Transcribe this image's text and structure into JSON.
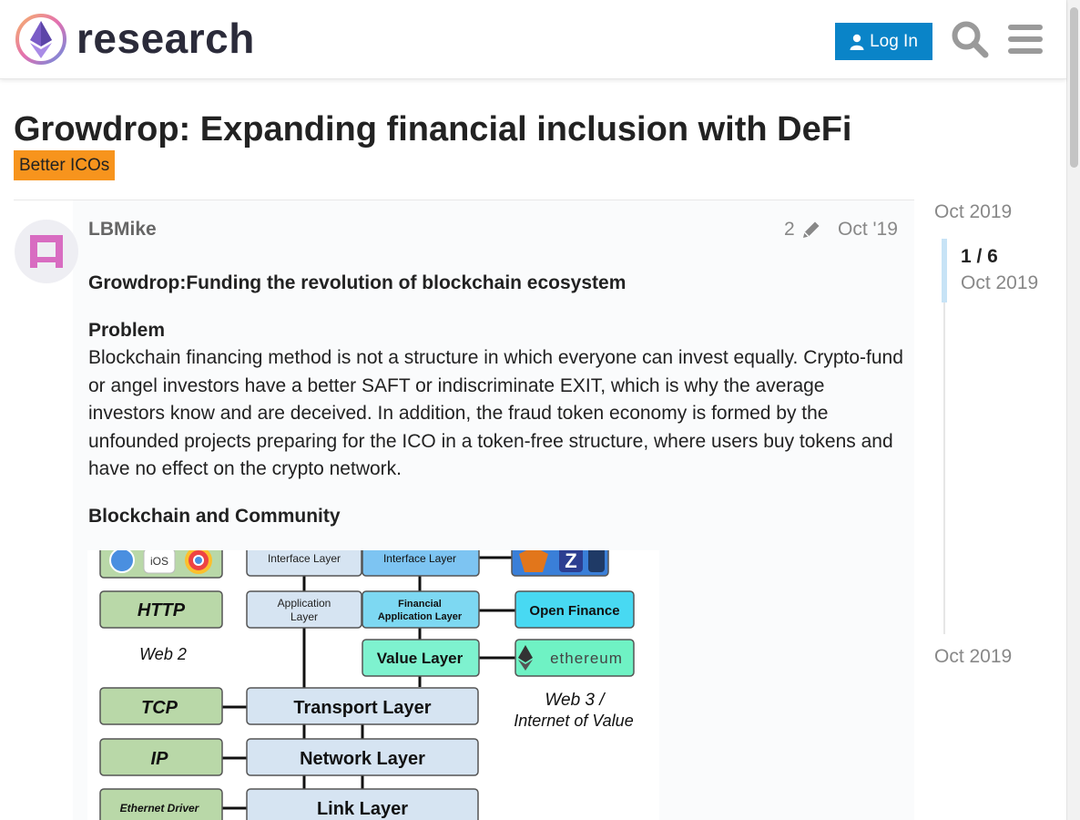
{
  "header": {
    "logo_word": "research",
    "login_label": "Log In"
  },
  "topic": {
    "title": "Growdrop: Expanding financial inclusion with DeFi",
    "category": "Better ICOs",
    "category_color": "#f7941d"
  },
  "post": {
    "username": "LBMike",
    "edit_count": "2",
    "date": "Oct '19",
    "heading": "Growdrop:Funding the revolution of blockchain ecosystem",
    "problem_title": "Problem",
    "problem_text": "Blockchain financing method is not a structure in which everyone can invest equally. Crypto-fund or angel investors have a better SAFT or indiscriminate EXIT, which is why the average investors know and are deceived. In addition, the fraud token economy is formed by the unfounded projects preparing for the ICO in a token-free structure, where users buy tokens and have no effect on the crypto network.",
    "section2_title": "Blockchain and Community"
  },
  "diagram": {
    "left": [
      "iOS",
      "HTTP",
      "Web 2",
      "TCP",
      "IP",
      "Ethernet Driver"
    ],
    "middle": [
      "Interface Layer",
      "Application Layer",
      "Transport Layer",
      "Network Layer",
      "Link Layer"
    ],
    "web3": [
      "Interface Layer",
      "Financial Application Layer",
      "Value Layer"
    ],
    "right": [
      "Open Finance",
      "ethereum",
      "Web 3 /",
      "Internet of Value"
    ]
  },
  "timeline": {
    "top_date": "Oct 2019",
    "position": "1 / 6",
    "position_date": "Oct 2019",
    "bottom_date": "Oct 2019"
  },
  "colors": {
    "accent": "#0a84c8",
    "avatar": "#d86cc1"
  }
}
